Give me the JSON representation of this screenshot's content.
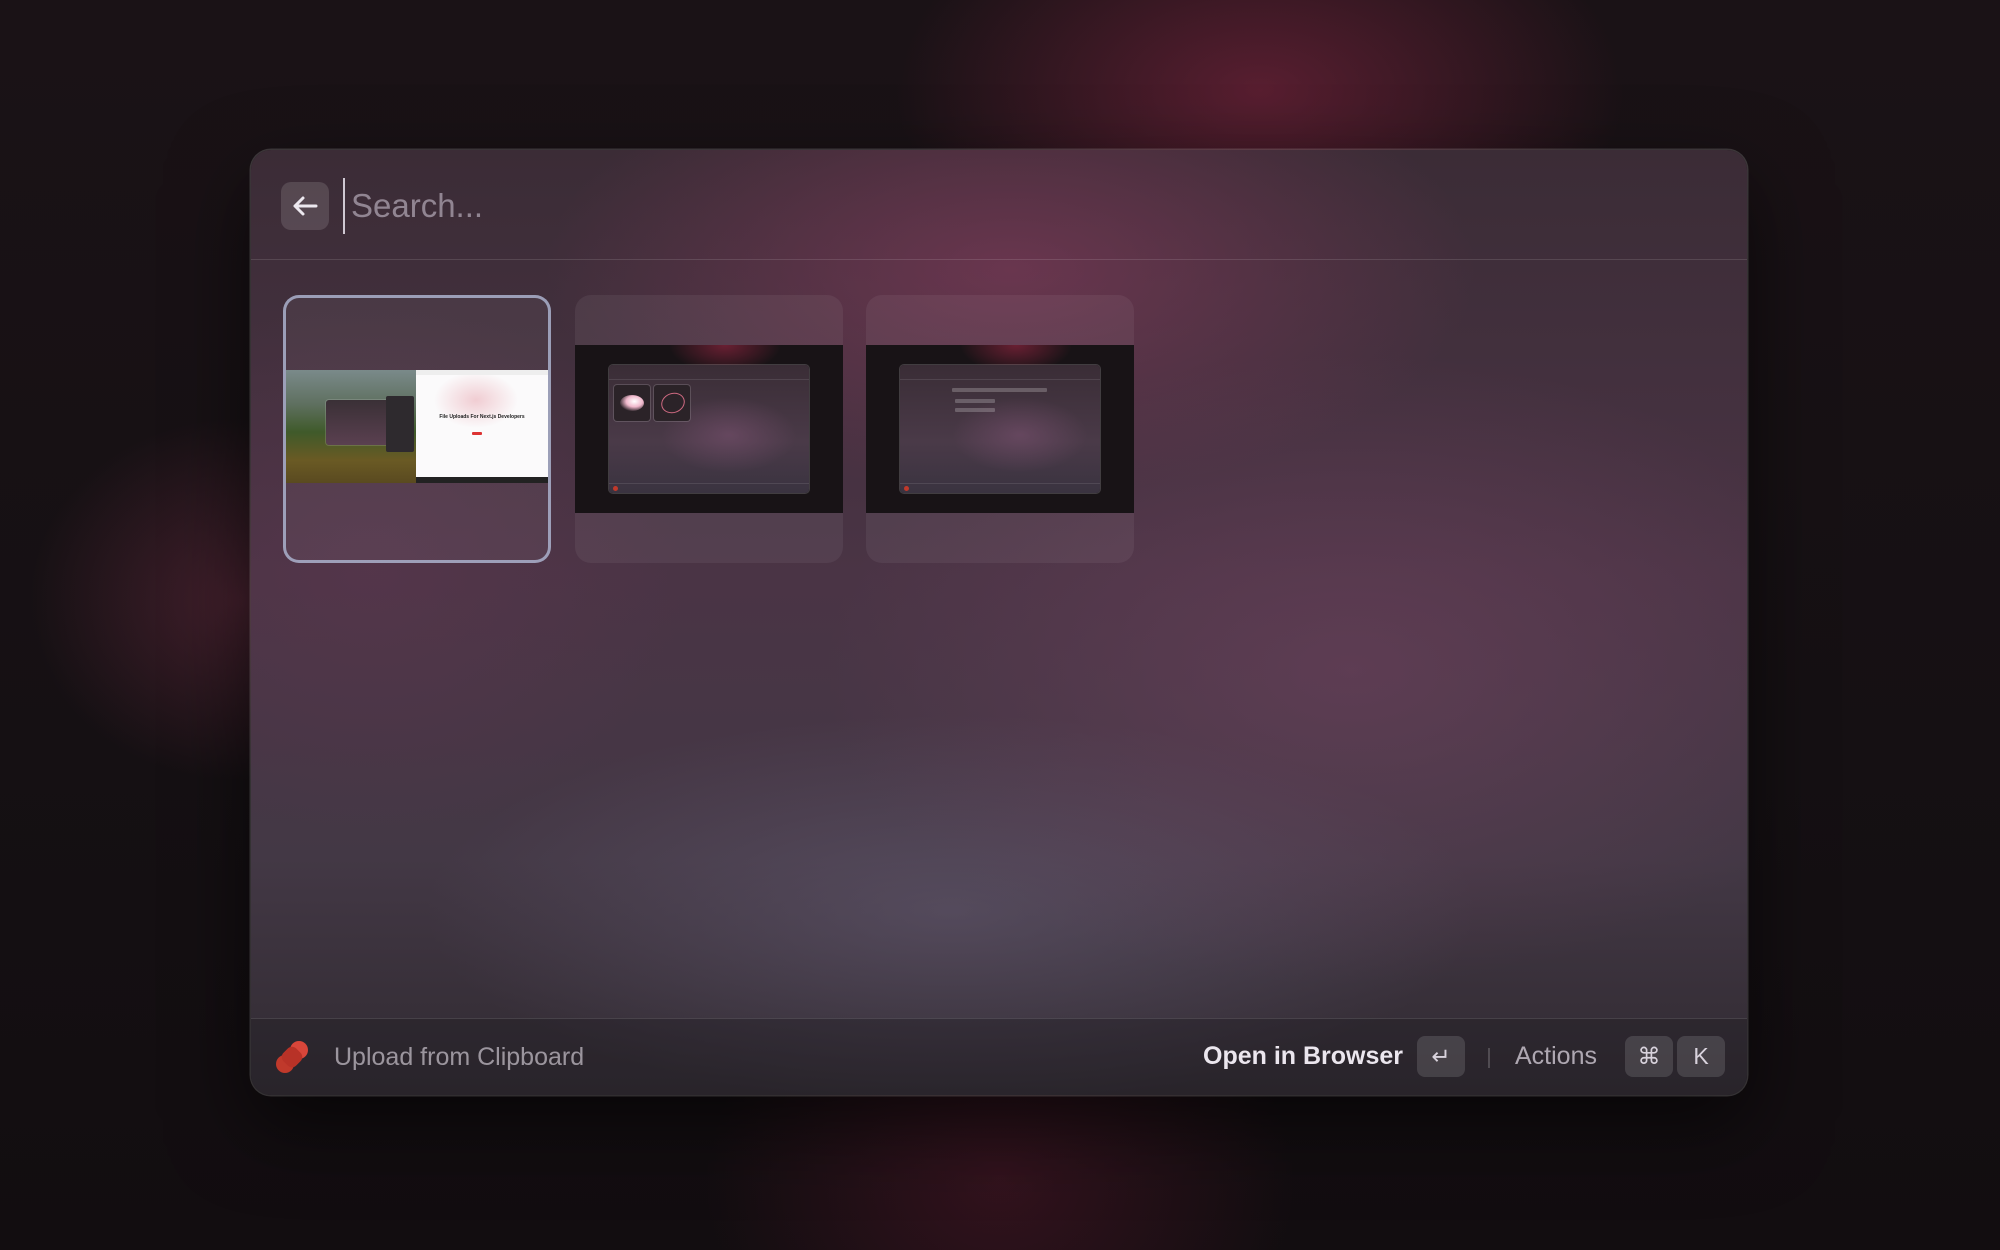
{
  "search": {
    "placeholder": "Search...",
    "value": ""
  },
  "header": {
    "back_icon": "arrow-left-icon"
  },
  "grid": {
    "items": [
      {
        "selected": true,
        "thumbnail_text": "File Uploads For Next.js Developers"
      },
      {
        "selected": false
      },
      {
        "selected": false
      }
    ]
  },
  "footer": {
    "app_icon": "uploadthing-logo-icon",
    "left_label": "Upload from Clipboard",
    "primary_action_label": "Open in Browser",
    "primary_action_key": "↵",
    "actions_label": "Actions",
    "actions_keys": [
      "⌘",
      "K"
    ]
  },
  "colors": {
    "accent_logo": "#c0392b",
    "selection_border": "#aab2cd"
  }
}
